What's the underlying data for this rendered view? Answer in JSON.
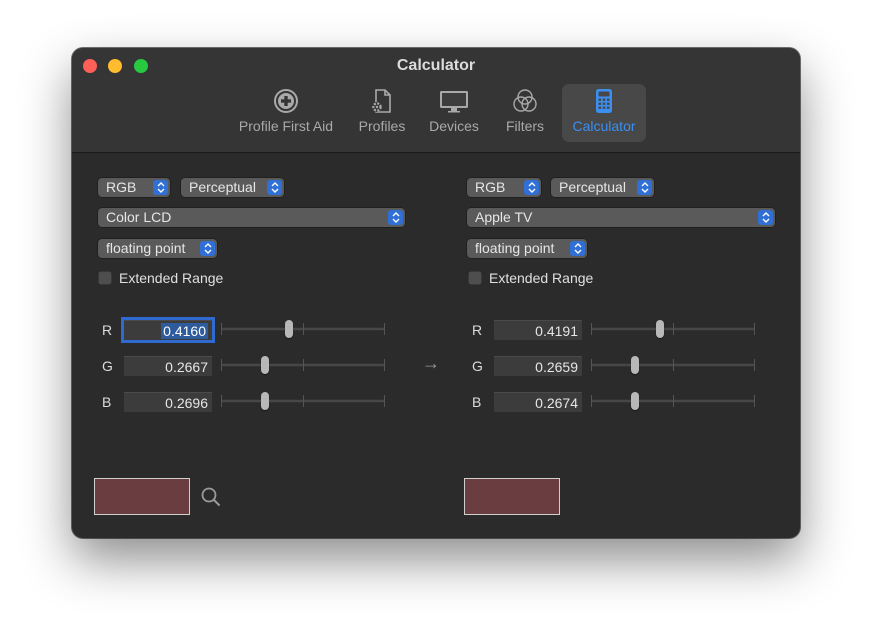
{
  "window": {
    "title": "Calculator"
  },
  "toolbar": {
    "items": [
      {
        "label": "Profile First Aid",
        "icon": "plus-circle-icon"
      },
      {
        "label": "Profiles",
        "icon": "document-gear-icon"
      },
      {
        "label": "Devices",
        "icon": "monitor-icon"
      },
      {
        "label": "Filters",
        "icon": "overlapping-circles-icon"
      },
      {
        "label": "Calculator",
        "icon": "calculator-icon"
      }
    ],
    "active_index": 4,
    "active_color": "#3b8ff0"
  },
  "left": {
    "color_space": "RGB",
    "intent": "Perceptual",
    "profile": "Color LCD",
    "format": "floating point",
    "extended_range_label": "Extended Range",
    "extended_range_checked": false,
    "channels": [
      {
        "label": "R",
        "value": "0.4160",
        "level": 0.416
      },
      {
        "label": "G",
        "value": "0.2667",
        "level": 0.2667
      },
      {
        "label": "B",
        "value": "0.2696",
        "level": 0.2696
      }
    ],
    "swatch_color": "#6a3d40"
  },
  "right": {
    "color_space": "RGB",
    "intent": "Perceptual",
    "profile": "Apple TV",
    "format": "floating point",
    "extended_range_label": "Extended Range",
    "extended_range_checked": false,
    "channels": [
      {
        "label": "R",
        "value": "0.4191",
        "level": 0.4191
      },
      {
        "label": "G",
        "value": "0.2659",
        "level": 0.2659
      },
      {
        "label": "B",
        "value": "0.2674",
        "level": 0.2674
      }
    ],
    "swatch_color": "#6a3e41"
  },
  "arrow": "→"
}
